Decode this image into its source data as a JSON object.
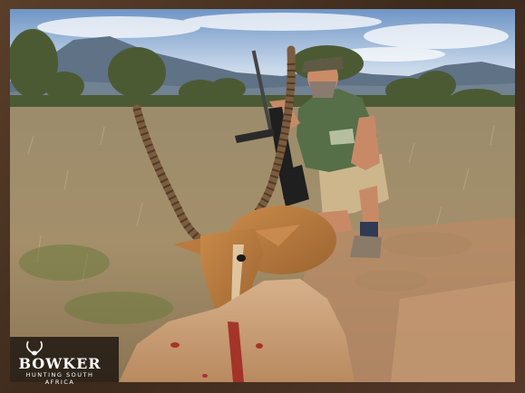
{
  "logo": {
    "brand": "BOWKER",
    "tagline": "HUNTING SOUTH AFRICA"
  },
  "colors": {
    "frame": "#4a3524",
    "sky": "#a9c3e0",
    "grass": "#a08c68",
    "antelope": "#b8743a",
    "shirt": "#4f6b45"
  }
}
